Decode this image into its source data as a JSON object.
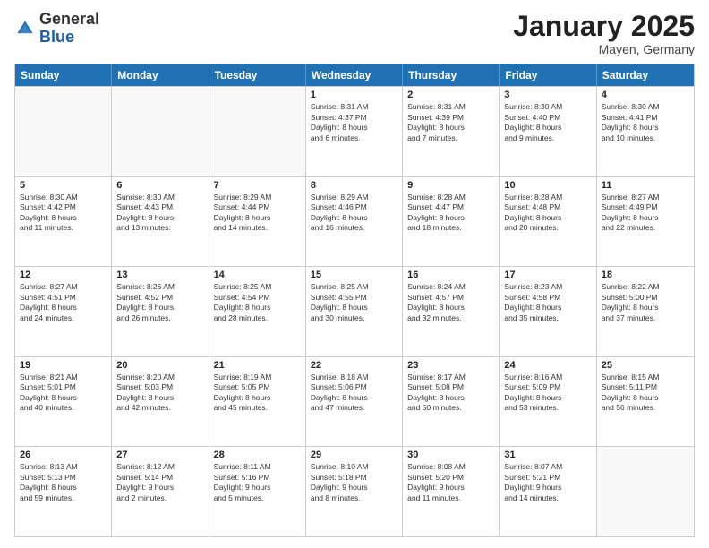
{
  "header": {
    "logo_general": "General",
    "logo_blue": "Blue",
    "month": "January 2025",
    "location": "Mayen, Germany"
  },
  "days_of_week": [
    "Sunday",
    "Monday",
    "Tuesday",
    "Wednesday",
    "Thursday",
    "Friday",
    "Saturday"
  ],
  "rows": [
    [
      {
        "day": "",
        "text": ""
      },
      {
        "day": "",
        "text": ""
      },
      {
        "day": "",
        "text": ""
      },
      {
        "day": "1",
        "text": "Sunrise: 8:31 AM\nSunset: 4:37 PM\nDaylight: 8 hours\nand 6 minutes."
      },
      {
        "day": "2",
        "text": "Sunrise: 8:31 AM\nSunset: 4:39 PM\nDaylight: 8 hours\nand 7 minutes."
      },
      {
        "day": "3",
        "text": "Sunrise: 8:30 AM\nSunset: 4:40 PM\nDaylight: 8 hours\nand 9 minutes."
      },
      {
        "day": "4",
        "text": "Sunrise: 8:30 AM\nSunset: 4:41 PM\nDaylight: 8 hours\nand 10 minutes."
      }
    ],
    [
      {
        "day": "5",
        "text": "Sunrise: 8:30 AM\nSunset: 4:42 PM\nDaylight: 8 hours\nand 11 minutes."
      },
      {
        "day": "6",
        "text": "Sunrise: 8:30 AM\nSunset: 4:43 PM\nDaylight: 8 hours\nand 13 minutes."
      },
      {
        "day": "7",
        "text": "Sunrise: 8:29 AM\nSunset: 4:44 PM\nDaylight: 8 hours\nand 14 minutes."
      },
      {
        "day": "8",
        "text": "Sunrise: 8:29 AM\nSunset: 4:46 PM\nDaylight: 8 hours\nand 16 minutes."
      },
      {
        "day": "9",
        "text": "Sunrise: 8:28 AM\nSunset: 4:47 PM\nDaylight: 8 hours\nand 18 minutes."
      },
      {
        "day": "10",
        "text": "Sunrise: 8:28 AM\nSunset: 4:48 PM\nDaylight: 8 hours\nand 20 minutes."
      },
      {
        "day": "11",
        "text": "Sunrise: 8:27 AM\nSunset: 4:49 PM\nDaylight: 8 hours\nand 22 minutes."
      }
    ],
    [
      {
        "day": "12",
        "text": "Sunrise: 8:27 AM\nSunset: 4:51 PM\nDaylight: 8 hours\nand 24 minutes."
      },
      {
        "day": "13",
        "text": "Sunrise: 8:26 AM\nSunset: 4:52 PM\nDaylight: 8 hours\nand 26 minutes."
      },
      {
        "day": "14",
        "text": "Sunrise: 8:25 AM\nSunset: 4:54 PM\nDaylight: 8 hours\nand 28 minutes."
      },
      {
        "day": "15",
        "text": "Sunrise: 8:25 AM\nSunset: 4:55 PM\nDaylight: 8 hours\nand 30 minutes."
      },
      {
        "day": "16",
        "text": "Sunrise: 8:24 AM\nSunset: 4:57 PM\nDaylight: 8 hours\nand 32 minutes."
      },
      {
        "day": "17",
        "text": "Sunrise: 8:23 AM\nSunset: 4:58 PM\nDaylight: 8 hours\nand 35 minutes."
      },
      {
        "day": "18",
        "text": "Sunrise: 8:22 AM\nSunset: 5:00 PM\nDaylight: 8 hours\nand 37 minutes."
      }
    ],
    [
      {
        "day": "19",
        "text": "Sunrise: 8:21 AM\nSunset: 5:01 PM\nDaylight: 8 hours\nand 40 minutes."
      },
      {
        "day": "20",
        "text": "Sunrise: 8:20 AM\nSunset: 5:03 PM\nDaylight: 8 hours\nand 42 minutes."
      },
      {
        "day": "21",
        "text": "Sunrise: 8:19 AM\nSunset: 5:05 PM\nDaylight: 8 hours\nand 45 minutes."
      },
      {
        "day": "22",
        "text": "Sunrise: 8:18 AM\nSunset: 5:06 PM\nDaylight: 8 hours\nand 47 minutes."
      },
      {
        "day": "23",
        "text": "Sunrise: 8:17 AM\nSunset: 5:08 PM\nDaylight: 8 hours\nand 50 minutes."
      },
      {
        "day": "24",
        "text": "Sunrise: 8:16 AM\nSunset: 5:09 PM\nDaylight: 8 hours\nand 53 minutes."
      },
      {
        "day": "25",
        "text": "Sunrise: 8:15 AM\nSunset: 5:11 PM\nDaylight: 8 hours\nand 56 minutes."
      }
    ],
    [
      {
        "day": "26",
        "text": "Sunrise: 8:13 AM\nSunset: 5:13 PM\nDaylight: 8 hours\nand 59 minutes."
      },
      {
        "day": "27",
        "text": "Sunrise: 8:12 AM\nSunset: 5:14 PM\nDaylight: 9 hours\nand 2 minutes."
      },
      {
        "day": "28",
        "text": "Sunrise: 8:11 AM\nSunset: 5:16 PM\nDaylight: 9 hours\nand 5 minutes."
      },
      {
        "day": "29",
        "text": "Sunrise: 8:10 AM\nSunset: 5:18 PM\nDaylight: 9 hours\nand 8 minutes."
      },
      {
        "day": "30",
        "text": "Sunrise: 8:08 AM\nSunset: 5:20 PM\nDaylight: 9 hours\nand 11 minutes."
      },
      {
        "day": "31",
        "text": "Sunrise: 8:07 AM\nSunset: 5:21 PM\nDaylight: 9 hours\nand 14 minutes."
      },
      {
        "day": "",
        "text": ""
      }
    ]
  ]
}
